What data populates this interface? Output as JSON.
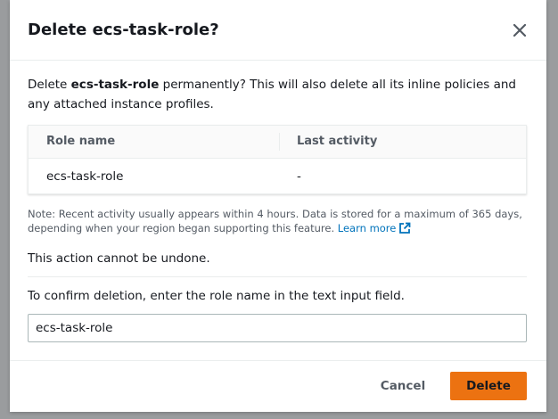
{
  "dialog": {
    "title": "Delete ecs-task-role?",
    "close_icon": "close-icon",
    "intro": {
      "prefix": "Delete ",
      "role_name": "ecs-task-role",
      "suffix": " permanently? This will also delete all its inline policies and any attached instance profiles."
    },
    "table": {
      "columns": [
        "Role name",
        "Last activity"
      ],
      "rows": [
        [
          "ecs-task-role",
          "-"
        ]
      ]
    },
    "note": {
      "text": "Note: Recent activity usually appears within 4 hours. Data is stored for a maximum of 365 days, depending when your region began supporting this feature. ",
      "link_label": "Learn more",
      "link_icon": "external-link-icon"
    },
    "warning": "This action cannot be undone.",
    "confirm": {
      "label": "To confirm deletion, enter the role name in the text input field.",
      "value": "ecs-task-role"
    },
    "footer": {
      "cancel_label": "Cancel",
      "delete_label": "Delete"
    }
  },
  "colors": {
    "primary_button": "#ec7211",
    "link": "#0073bb",
    "text": "#16191f",
    "muted_text": "#545b64"
  }
}
